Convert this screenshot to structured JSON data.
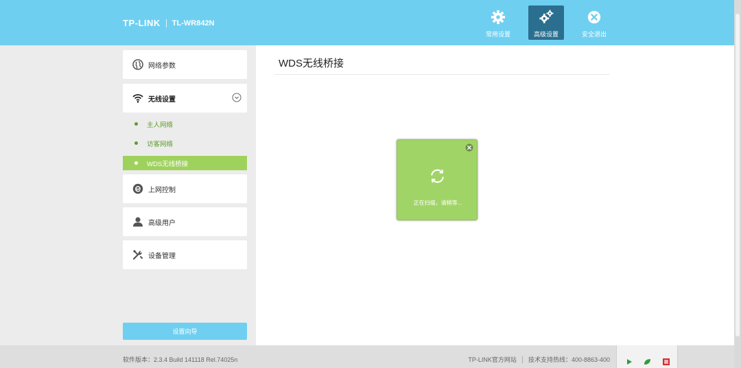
{
  "header": {
    "brand": "TP-LINK",
    "model": "TL-WR842N",
    "nav": [
      {
        "label": "常用设置",
        "icon": "gear-icon",
        "active": false
      },
      {
        "label": "高级设置",
        "icon": "gears-icon",
        "active": true
      },
      {
        "label": "安全退出",
        "icon": "close-circle-icon",
        "active": false
      }
    ]
  },
  "sidebar": {
    "items": [
      {
        "label": "网络参数",
        "icon": "globe-icon"
      },
      {
        "label": "无线设置",
        "icon": "wifi-icon"
      },
      {
        "label": "上网控制",
        "icon": "internet-e-icon"
      },
      {
        "label": "高级用户",
        "icon": "user-icon"
      },
      {
        "label": "设备管理",
        "icon": "tools-icon"
      }
    ],
    "wireless_sub": [
      {
        "label": "主人网络"
      },
      {
        "label": "访客网络"
      },
      {
        "label": "WDS无线桥接",
        "active": true
      }
    ],
    "wizard_label": "设置向导"
  },
  "main": {
    "title": "WDS无线桥接",
    "scan_message": "正在扫描，请稍等..."
  },
  "footer": {
    "version": "软件版本：2.3.4 Build 141118 Rel.74025n",
    "official_site": "TP-LINK官方网站",
    "support": "技术支持热线：400-8863-400"
  },
  "colors": {
    "header_bg": "#6fcff0",
    "active_nav": "#2a6f8f",
    "active_menu": "#9fd25d",
    "dialog_bg": "#a1d467"
  }
}
